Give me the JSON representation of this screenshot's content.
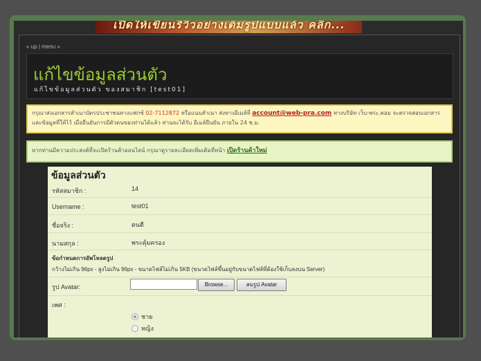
{
  "banner": {
    "text": "เปิดให้เขียนรีวิวอย่างเต็มรูปแบบแล้ว คลิก..."
  },
  "nav": {
    "up": "« up",
    "menu": "menu »",
    "separator": "|"
  },
  "header": {
    "title": "แก้ไขข้อมูลส่วนตัว",
    "subtitle": "แก้ไขข้อมูลส่วนตัว ของสมาชิก [test01]"
  },
  "notice_docs": {
    "text_1": "กรุณาส่งเอกสารสำเนาบัตรประชาชนทางแฟกซ์",
    "fax": "02-7112872",
    "text_2": "หรือแนบสำเนา ส่งทางอีเมล์ที่",
    "email": "account@web-pra.com",
    "text_3": "ทางบริษัท เว็บ-พระ.คอม จะตรวจสอบเอกสารและข้อมูลที่ให้ไว้ เมื่อยืนยันการมีตัวตนของท่านได้แล้ว ท่านจะได้รับ อีเมล์ยืนยัน ภายใน 24 ช.ม."
  },
  "notice_shop": {
    "text": "หากท่านมีความประสงค์ที่จะเปิดร้านค้าออนไลน์ กรุณาดูรายละเอียดเพิ่มเติมที่หน้า",
    "link": "เปิดร้านค้าใหม่"
  },
  "form": {
    "title": "ข้อมูลส่วนตัว",
    "member_id": {
      "label": "รหัสสมาชิก :",
      "value": "14"
    },
    "username": {
      "label": "Username :",
      "value": "test01"
    },
    "first_name": {
      "label": "ชื่อจริง :",
      "value": "ตนตี"
    },
    "last_name": {
      "label": "นามสกุล :",
      "value": "พระคุ้มครอง"
    },
    "upload_rules": {
      "title": "ข้อกำหนดการอัพโหลดรูป",
      "text": "กว้างไม่เกิน 96px - สูงไม่เกิน 96px - ขนาดไฟล์ไม่เกิน 5KB (ขนาดไฟล์ขึ้นอยู่กับขนาดไฟล์ที่ต้องใช้เก็บลงบน Server)"
    },
    "avatar": {
      "label": "รูป Avatar:",
      "browse": "Browse...",
      "delete": "ลบรูป Avatar"
    },
    "gender": {
      "label": "เพศ :",
      "options": [
        "ชาย",
        "หญิง"
      ],
      "selected": "ชาย"
    }
  }
}
